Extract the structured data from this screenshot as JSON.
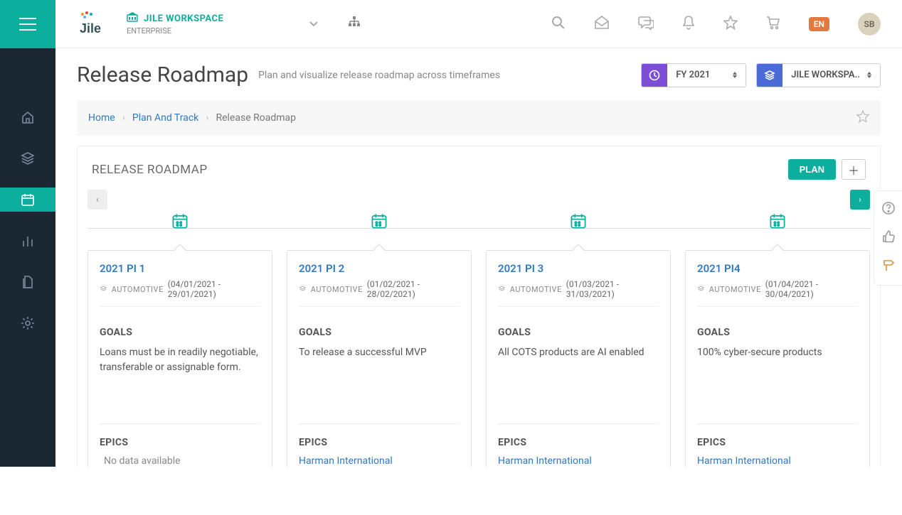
{
  "header": {
    "workspace": "JILE WORKSPACE",
    "workspace_type": "ENTERPRISE",
    "lang": "EN",
    "user_initials": "SB"
  },
  "selectors": {
    "period": "FY 2021",
    "scope": "JILE WORKSPA.."
  },
  "page": {
    "title": "Release Roadmap",
    "subtitle": "Plan and visualize release roadmap across timeframes"
  },
  "breadcrumbs": {
    "home": "Home",
    "mid": "Plan And Track",
    "current": "Release Roadmap"
  },
  "panel": {
    "title": "RELEASE ROADMAP",
    "plan_label": "PLAN"
  },
  "labels": {
    "goals": "GOALS",
    "epics": "EPICS",
    "nodata": "No data available"
  },
  "cards": [
    {
      "title": "2021 PI 1",
      "tag": "AUTOMOTIVE",
      "dates": "(04/01/2021 - 29/01/2021)",
      "goal": "Loans must be in readily negotiable, transferable or assignable form.",
      "epic": ""
    },
    {
      "title": "2021 PI 2",
      "tag": "AUTOMOTIVE",
      "dates": "(01/02/2021 - 28/02/2021)",
      "goal": "To release a successful MVP",
      "epic": "Harman International"
    },
    {
      "title": "2021 PI 3",
      "tag": "AUTOMOTIVE",
      "dates": "(01/03/2021 - 31/03/2021)",
      "goal": "All COTS products are AI enabled",
      "epic": "Harman International"
    },
    {
      "title": "2021 PI4",
      "tag": "AUTOMOTIVE",
      "dates": "(01/04/2021 - 30/04/2021)",
      "goal": "100% cyber-secure products",
      "epic": "Harman International"
    }
  ]
}
